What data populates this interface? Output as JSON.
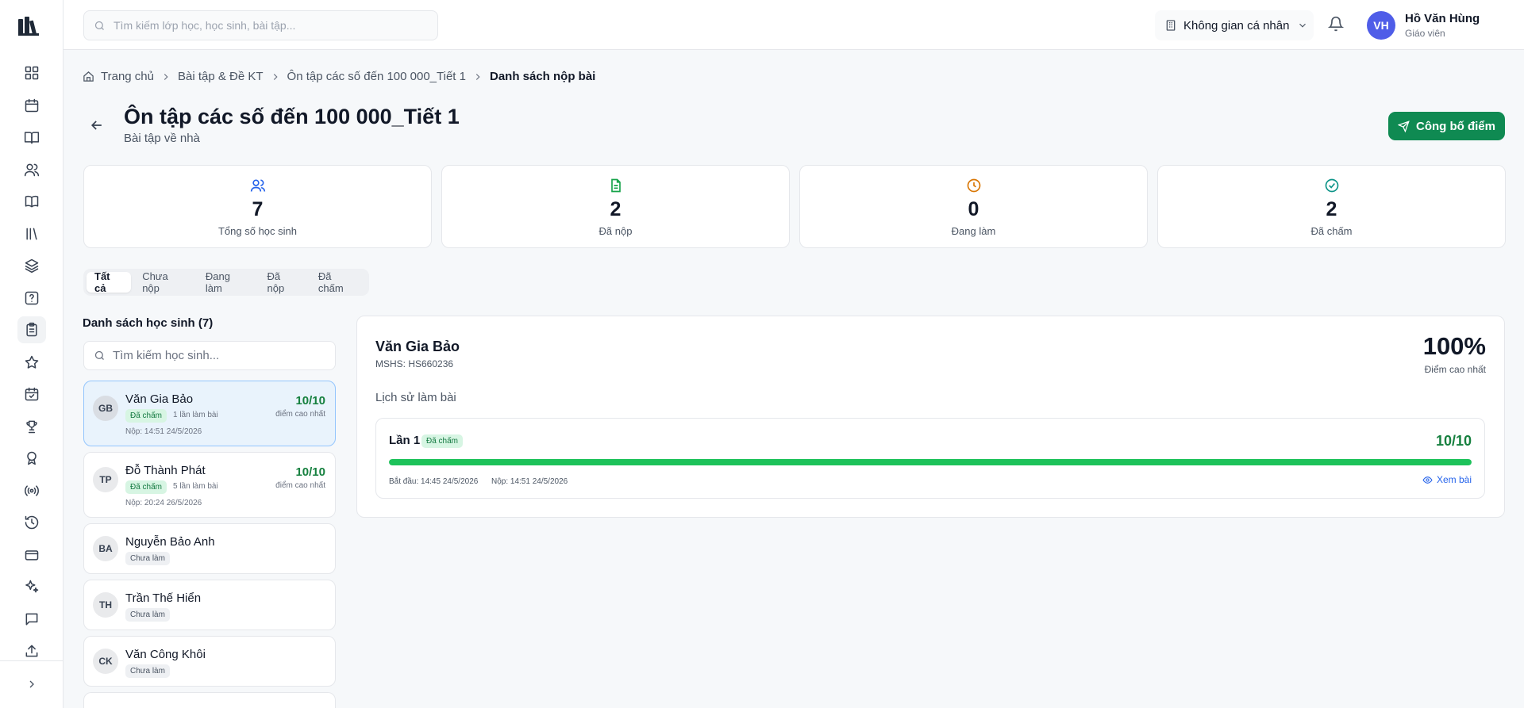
{
  "topbar": {
    "search_placeholder": "Tìm kiếm lớp học, học sinh, bài tập...",
    "workspace": "Không gian cá nhân",
    "user": {
      "initials": "VH",
      "name": "Hồ Văn Hùng",
      "role": "Giáo viên"
    }
  },
  "sidebar": {
    "icons": [
      "dashboard-icon",
      "calendar-icon",
      "book-open-icon",
      "users-icon",
      "book-icon",
      "library-icon",
      "layers-icon",
      "help-icon",
      "clipboard-icon",
      "star-icon",
      "calendar-check-icon",
      "trophy-icon",
      "award-icon",
      "radio-icon",
      "history-icon",
      "card-icon",
      "sparkles-icon",
      "message-icon",
      "upload-icon"
    ],
    "active": "clipboard-icon"
  },
  "breadcrumb": [
    "Trang chủ",
    "Bài tập & Đề KT",
    "Ôn tập các số đến 100 000_Tiết 1",
    "Danh sách nộp bài"
  ],
  "page": {
    "title": "Ôn tập các số đến 100 000_Tiết 1",
    "subtitle": "Bài tập về nhà",
    "publish_label": "Công bố điểm"
  },
  "stats": [
    {
      "value": "7",
      "label": "Tổng số học sinh",
      "icon": "users-icon",
      "color": "#2563eb"
    },
    {
      "value": "2",
      "label": "Đã nộp",
      "icon": "file-icon",
      "color": "#16a34a"
    },
    {
      "value": "0",
      "label": "Đang làm",
      "icon": "clock-icon",
      "color": "#d97706"
    },
    {
      "value": "2",
      "label": "Đã chấm",
      "icon": "check-circle-icon",
      "color": "#0d9488"
    }
  ],
  "tabs": [
    "Tất cả",
    "Chưa nộp",
    "Đang làm",
    "Đã nộp",
    "Đã chấm"
  ],
  "list": {
    "title": "Danh sách học sinh (7)",
    "search_placeholder": "Tìm kiếm học sinh...",
    "students": [
      {
        "initials": "GB",
        "name": "Văn Gia Bảo",
        "status": "Đã chấm",
        "attempts": "1 lần làm bài",
        "submitted": "Nộp: 14:51 24/5/2026",
        "score": "10/10",
        "score_label": "điểm cao nhất"
      },
      {
        "initials": "TP",
        "name": "Đỗ Thành Phát",
        "status": "Đã chấm",
        "attempts": "5 lần làm bài",
        "submitted": "Nộp: 20:24 26/5/2026",
        "score": "10/10",
        "score_label": "điểm cao nhất"
      },
      {
        "initials": "BA",
        "name": "Nguyễn Bảo Anh",
        "status": "Chưa làm"
      },
      {
        "initials": "TH",
        "name": "Trần Thế Hiển",
        "status": "Chưa làm"
      },
      {
        "initials": "CK",
        "name": "Văn Công Khôi",
        "status": "Chưa làm"
      }
    ]
  },
  "detail": {
    "name": "Văn Gia Bảo",
    "student_id": "MSHS: HS660236",
    "best_percent": "100%",
    "best_label": "Điểm cao nhất",
    "history_title": "Lịch sử làm bài",
    "attempt": {
      "label": "Lần 1",
      "status": "Đã chấm",
      "score": "10/10",
      "progress": 1.0,
      "start": "Bắt đầu: 14:45 24/5/2026",
      "submit": "Nộp: 14:51 24/5/2026",
      "view_label": "Xem bài"
    }
  }
}
